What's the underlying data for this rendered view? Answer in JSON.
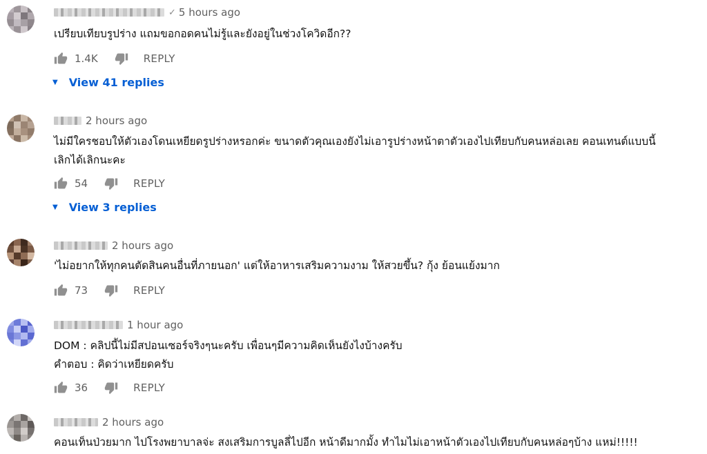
{
  "comments": [
    {
      "time": "5 hours ago",
      "verified": true,
      "text": "เปรียบเทียบรูปร่าง แถมขอกอดคนไม่รู้และยังอยู่ในช่วงโควิดอีก??",
      "likes": "1.4K",
      "reply_label": "REPLY",
      "view_replies": "View 41 replies",
      "avatar_colors": [
        "#b8b0b6",
        "#9e969b",
        "#c7c0c4",
        "#8c8489",
        "#a59ca3",
        "#d2cbcf",
        "#7e777c",
        "#b0a8ad",
        "#968e93",
        "#c1bac0",
        "#a7a0a5",
        "#8f878c",
        "#bab3b8",
        "#9a9297",
        "#cfc8cc",
        "#877f85"
      ]
    },
    {
      "time": "2 hours ago",
      "verified": false,
      "text": "ไม่มีใครชอบให้ตัวเองโดนเหยียดรูปร่างหรอกค่ะ ขนาดตัวคุณเองยังไม่เอารูปร่างหน้าตาตัวเองไปเทียบกับคนหล่อเลย คอนเทนต์แบบนี้\nเลิกได้เลิกนะคะ",
      "likes": "54",
      "reply_label": "REPLY",
      "view_replies": "View 3 replies",
      "avatar_colors": [
        "#b39d8a",
        "#8f7a69",
        "#c9b7a6",
        "#a08876",
        "#7d6a5a",
        "#d0c1b3",
        "#9b8574",
        "#b6a292",
        "#85705f",
        "#c2ae9c",
        "#a8917f",
        "#927c6b",
        "#bfa998",
        "#8a7463",
        "#ccbba9",
        "#a38c7a"
      ]
    },
    {
      "time": "2 hours ago",
      "verified": false,
      "text": "'ไม่อยากให้ทุกคนตัดสินคนอื่นที่ภายนอก' แต่ให้อาหารเสริมความงาม ให้สวยขึ้น? กุ้ง ย้อนแย้งมาก",
      "likes": "73",
      "reply_label": "REPLY",
      "avatar_colors": [
        "#5a3d2c",
        "#8a6650",
        "#3e2a1f",
        "#a0806a",
        "#6e4e3b",
        "#c4a58e",
        "#4a3325",
        "#7b5a46",
        "#b69378",
        "#553a2a",
        "#8f6c55",
        "#d3b8a2",
        "#62453a",
        "#a6836a",
        "#3a2519",
        "#7f5f4b"
      ]
    },
    {
      "time": "1 hour ago",
      "verified": false,
      "text": "DOM : คลิปนี้ไม่มีสปอนเซอร์จริงๆนะครับ เพื่อนๆมีความคิดเห็นยังไงบ้างครับ\nคำตอบ : คิดว่าเหยียดครับ",
      "likes": "36",
      "reply_label": "REPLY",
      "avatar_colors": [
        "#9aa4e8",
        "#6d7bd9",
        "#b8c0f2",
        "#5865cf",
        "#7f8be0",
        "#c7cdf6",
        "#4c59c6",
        "#a3acec",
        "#6a77d6",
        "#8c97e4",
        "#b1b9f0",
        "#5b68d1",
        "#7884dd",
        "#d0d5f8",
        "#6270d3",
        "#9ea8ea"
      ]
    },
    {
      "time": "2 hours ago",
      "verified": false,
      "text": "คอนเท็นป่วยมาก ไปโรงพยาบาลจ่ะ สงเสริมการบูลลี่ไปอีก หน้าดีมากมั้ง ทำไมไม่เอาหน้าตัวเองไปเทียบกับคนหล่อๆบ้าง แหม่!!!!!",
      "likes": "",
      "reply_label": "REPLY",
      "avatar_colors": [
        "#8a8684",
        "#b3aeab",
        "#6d6866",
        "#c6c1be",
        "#9a9592",
        "#7a7573",
        "#a9a4a1",
        "#5f5a58",
        "#bdb8b5",
        "#8f8a87",
        "#d1ccc9",
        "#76716f",
        "#a2a19e",
        "#69645f",
        "#b8b3b0",
        "#85807d"
      ]
    }
  ]
}
